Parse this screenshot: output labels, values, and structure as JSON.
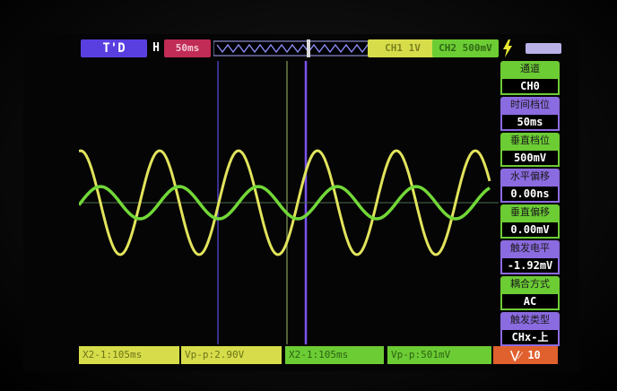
{
  "topbar": {
    "trigger_mode": "T'D",
    "timebase_label": "H",
    "timebase_value": "50ms",
    "ch1_scale": "CH1 1V",
    "ch2_scale": "CH2 500mV"
  },
  "menu": [
    {
      "title": "通道",
      "value": "CH0",
      "color": "#6ccc34"
    },
    {
      "title": "时间档位",
      "value": "50ms",
      "color": "#8b6be0"
    },
    {
      "title": "垂直档位",
      "value": "500mV",
      "color": "#6ccc34"
    },
    {
      "title": "水平偏移",
      "value": "0.00ns",
      "color": "#8b6be0"
    },
    {
      "title": "垂直偏移",
      "value": "0.00mV",
      "color": "#6ccc34"
    },
    {
      "title": "触发电平",
      "value": "-1.92mV",
      "color": "#8b6be0"
    },
    {
      "title": "耦合方式",
      "value": "AC",
      "color": "#6ccc34"
    },
    {
      "title": "触发类型",
      "value": "CHx-上",
      "color": "#8b6be0"
    }
  ],
  "measurements": {
    "m1": "X2-1:105ms",
    "m2": "Vp-p:2.90V",
    "m3": "X2-1:105ms",
    "m4": "Vp-p:501mV"
  },
  "probe_ratio": "10",
  "colors": {
    "ch1": "#e2e45c",
    "ch2": "#72d838",
    "cursor": "#7a52f0",
    "trigger_line": "#4a6a4a"
  },
  "icons": [
    "lightning-icon",
    "battery-icon",
    "trigger-marker-icon"
  ]
}
